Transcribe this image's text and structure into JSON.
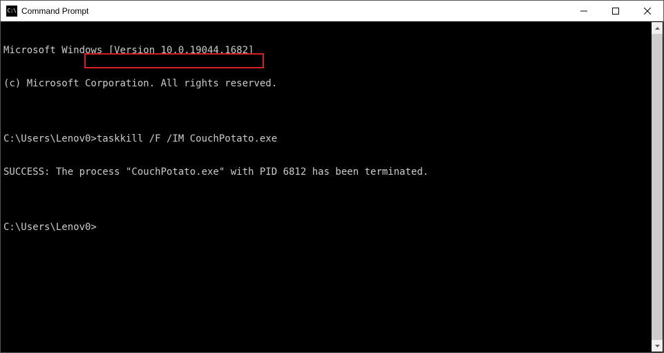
{
  "window": {
    "title": "Command Prompt",
    "icon_label": "cmd-icon"
  },
  "terminal": {
    "lines": [
      "Microsoft Windows [Version 10.0.19044.1682]",
      "(c) Microsoft Corporation. All rights reserved.",
      "",
      "C:\\Users\\Lenov0>taskkill /F /IM CouchPotato.exe",
      "SUCCESS: The process \"CouchPotato.exe\" with PID 6812 has been terminated.",
      "",
      "C:\\Users\\Lenov0>"
    ],
    "prompt_prefix": "C:\\Users\\Lenov0>",
    "highlighted_command": "taskkill /F /IM CouchPotato.exe"
  },
  "controls": {
    "minimize": "Minimize",
    "maximize": "Maximize",
    "close": "Close"
  }
}
